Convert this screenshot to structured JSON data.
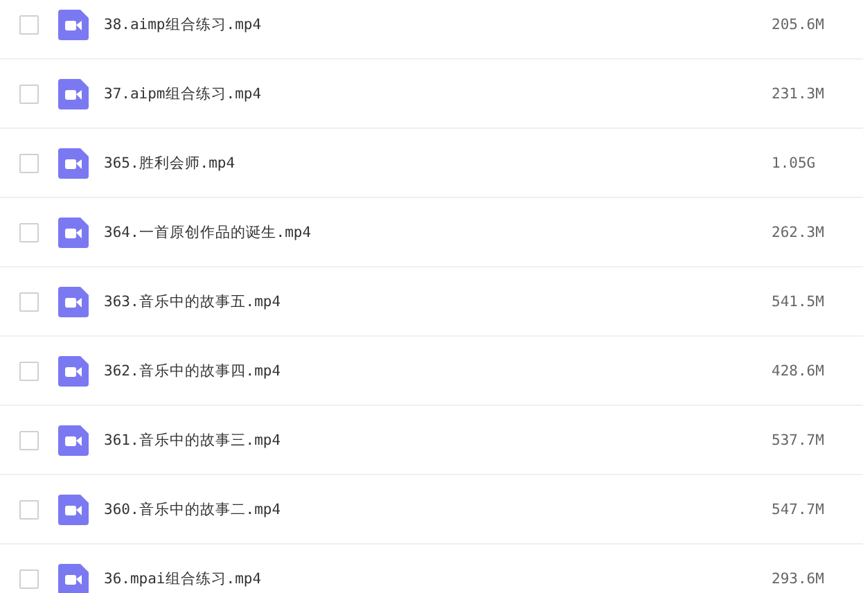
{
  "files": [
    {
      "name": "38.aimp组合练习.mp4",
      "size": "205.6M",
      "checked": false
    },
    {
      "name": "37.aipm组合练习.mp4",
      "size": "231.3M",
      "checked": false
    },
    {
      "name": "365.胜利会师.mp4",
      "size": "1.05G",
      "checked": false
    },
    {
      "name": "364.一首原创作品的诞生.mp4",
      "size": "262.3M",
      "checked": false
    },
    {
      "name": "363.音乐中的故事五.mp4",
      "size": "541.5M",
      "checked": false
    },
    {
      "name": "362.音乐中的故事四.mp4",
      "size": "428.6M",
      "checked": false
    },
    {
      "name": "361.音乐中的故事三.mp4",
      "size": "537.7M",
      "checked": false
    },
    {
      "name": "360.音乐中的故事二.mp4",
      "size": "547.7M",
      "checked": false
    },
    {
      "name": "36.mpai组合练习.mp4",
      "size": "293.6M",
      "checked": false
    }
  ]
}
